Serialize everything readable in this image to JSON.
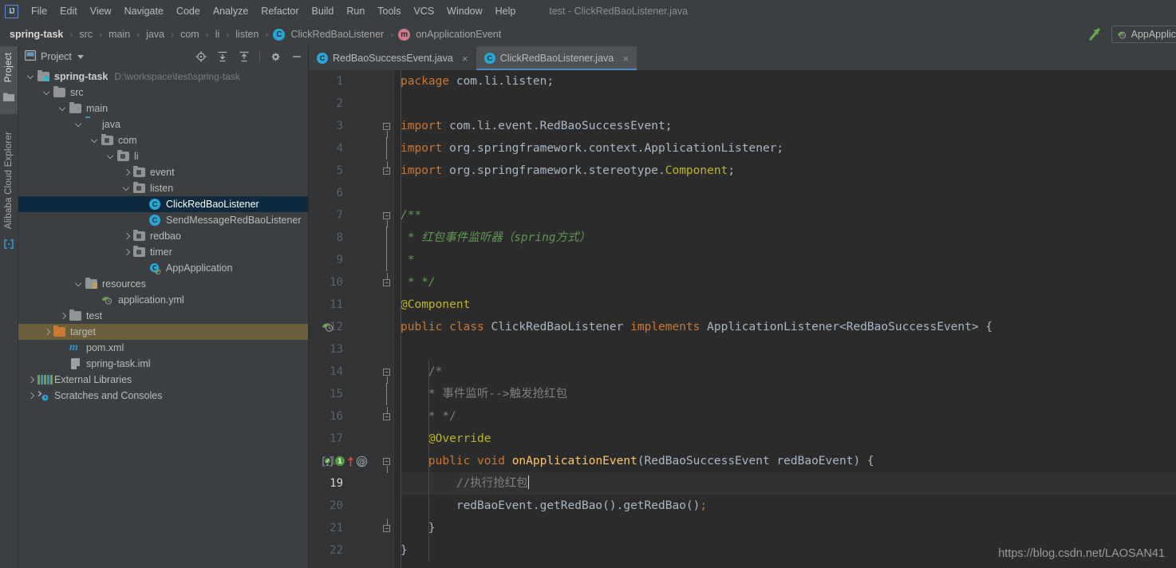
{
  "app": {
    "logo_text": "IJ",
    "window_title": "test - ClickRedBaoListener.java"
  },
  "menubar": {
    "items": [
      {
        "label": "File"
      },
      {
        "label": "Edit"
      },
      {
        "label": "View"
      },
      {
        "label": "Navigate"
      },
      {
        "label": "Code"
      },
      {
        "label": "Analyze"
      },
      {
        "label": "Refactor"
      },
      {
        "label": "Build"
      },
      {
        "label": "Run"
      },
      {
        "label": "Tools"
      },
      {
        "label": "VCS"
      },
      {
        "label": "Window"
      },
      {
        "label": "Help"
      }
    ]
  },
  "breadcrumb": {
    "items": [
      {
        "label": "spring-task",
        "icon": "none"
      },
      {
        "label": "src",
        "icon": "none"
      },
      {
        "label": "main",
        "icon": "none"
      },
      {
        "label": "java",
        "icon": "none"
      },
      {
        "label": "com",
        "icon": "none"
      },
      {
        "label": "li",
        "icon": "none"
      },
      {
        "label": "listen",
        "icon": "none"
      },
      {
        "label": "ClickRedBaoListener",
        "icon": "class-icon"
      },
      {
        "label": "onApplicationEvent",
        "icon": "method-icon"
      }
    ],
    "separator": "›"
  },
  "toolbar_right": {
    "run_config_label": "AppApplication",
    "run_icon": "run-arrow-icon",
    "config_icon": "spring-boot-icon",
    "accent_green": "#6aa84f"
  },
  "tool_strip": {
    "tabs": [
      {
        "label": "Project",
        "icon": "project-folder-icon",
        "active": true
      },
      {
        "label": "Alibaba Cloud Explorer",
        "icon": "cloud-bracket-icon",
        "active": false
      }
    ]
  },
  "project_panel": {
    "title": "Project",
    "tools": [
      {
        "name": "locate-icon"
      },
      {
        "name": "expand-all-icon"
      },
      {
        "name": "collapse-all-icon"
      },
      {
        "name": "settings-gear-icon"
      },
      {
        "name": "hide-panel-icon"
      }
    ],
    "tree": [
      {
        "label": "spring-task",
        "detail": "D:\\workspace\\test\\spring-task",
        "indent": 0,
        "arrow": "down",
        "icon": "module-folder",
        "bold": true
      },
      {
        "label": "src",
        "detail": "",
        "indent": 1,
        "arrow": "down",
        "icon": "folder-src",
        "bold": false
      },
      {
        "label": "main",
        "detail": "",
        "indent": 2,
        "arrow": "down",
        "icon": "folder-plain",
        "bold": false
      },
      {
        "label": "java",
        "detail": "",
        "indent": 3,
        "arrow": "down",
        "icon": "folder-sources",
        "bold": false
      },
      {
        "label": "com",
        "detail": "",
        "indent": 4,
        "arrow": "down",
        "icon": "folder-package",
        "bold": false
      },
      {
        "label": "li",
        "detail": "",
        "indent": 5,
        "arrow": "down",
        "icon": "folder-package",
        "bold": false
      },
      {
        "label": "event",
        "detail": "",
        "indent": 6,
        "arrow": "right",
        "icon": "folder-package",
        "bold": false
      },
      {
        "label": "listen",
        "detail": "",
        "indent": 6,
        "arrow": "down",
        "icon": "folder-package",
        "bold": false
      },
      {
        "label": "ClickRedBaoListener",
        "detail": "",
        "indent": 7,
        "arrow": "none",
        "icon": "java-class",
        "bold": false,
        "selected": true
      },
      {
        "label": "SendMessageRedBaoListener",
        "detail": "",
        "indent": 7,
        "arrow": "none",
        "icon": "java-class",
        "bold": false
      },
      {
        "label": "redbao",
        "detail": "",
        "indent": 6,
        "arrow": "right",
        "icon": "folder-package",
        "bold": false
      },
      {
        "label": "timer",
        "detail": "",
        "indent": 6,
        "arrow": "right",
        "icon": "folder-package",
        "bold": false
      },
      {
        "label": "AppApplication",
        "detail": "",
        "indent": 7,
        "arrow": "none",
        "icon": "spring-boot-class",
        "bold": false
      },
      {
        "label": "resources",
        "detail": "",
        "indent": 3,
        "arrow": "down",
        "icon": "folder-resources",
        "bold": false
      },
      {
        "label": "application.yml",
        "detail": "",
        "indent": 4,
        "arrow": "none",
        "icon": "spring-yml",
        "bold": false
      },
      {
        "label": "test",
        "detail": "",
        "indent": 2,
        "arrow": "right",
        "icon": "folder-plain",
        "bold": false
      },
      {
        "label": "target",
        "detail": "",
        "indent": 1,
        "arrow": "right",
        "icon": "folder-target",
        "bold": false,
        "excluded_highlight": true
      },
      {
        "label": "pom.xml",
        "detail": "",
        "indent": 2,
        "arrow": "none",
        "icon": "maven-icon",
        "bold": false
      },
      {
        "label": "spring-task.iml",
        "detail": "",
        "indent": 2,
        "arrow": "none",
        "icon": "iml-icon",
        "bold": false
      },
      {
        "label": "External Libraries",
        "detail": "",
        "indent": 0,
        "arrow": "right",
        "icon": "libraries-icon",
        "bold": false
      },
      {
        "label": "Scratches and Consoles",
        "detail": "",
        "indent": 0,
        "arrow": "right",
        "icon": "scratches-icon",
        "bold": false
      }
    ]
  },
  "editor": {
    "tabs": [
      {
        "label": "RedBaoSuccessEvent.java",
        "active": false,
        "close": "×"
      },
      {
        "label": "ClickRedBaoListener.java",
        "active": true,
        "close": "×"
      }
    ],
    "current_line": 19,
    "lines": [
      {
        "n": 1,
        "tokens": [
          {
            "t": "package ",
            "c": "kw"
          },
          {
            "t": "com.li.listen;",
            "c": "id"
          }
        ],
        "indent": 0
      },
      {
        "n": 2,
        "tokens": [],
        "indent": 0
      },
      {
        "n": 3,
        "tokens": [
          {
            "t": "import ",
            "c": "kw"
          },
          {
            "t": "com.li.event.RedBaoSuccessEvent;",
            "c": "id"
          }
        ],
        "indent": 0,
        "fold": "top"
      },
      {
        "n": 4,
        "tokens": [
          {
            "t": "import ",
            "c": "kw"
          },
          {
            "t": "org.springframework.context.ApplicationListener;",
            "c": "id"
          }
        ],
        "indent": 0,
        "fold": "line"
      },
      {
        "n": 5,
        "tokens": [
          {
            "t": "import ",
            "c": "kw"
          },
          {
            "t": "org.springframework.stereotype.",
            "c": "id"
          },
          {
            "t": "Component",
            "c": "type-hi"
          },
          {
            "t": ";",
            "c": "id"
          }
        ],
        "indent": 0,
        "fold": "bot"
      },
      {
        "n": 6,
        "tokens": [],
        "indent": 0
      },
      {
        "n": 7,
        "tokens": [
          {
            "t": "/**",
            "c": "doc"
          }
        ],
        "indent": 0,
        "fold": "top"
      },
      {
        "n": 8,
        "tokens": [
          {
            "t": " * 红包事件监听器（spring方式）",
            "c": "doc"
          }
        ],
        "indent": 0,
        "fold": "line"
      },
      {
        "n": 9,
        "tokens": [
          {
            "t": " *",
            "c": "doc"
          }
        ],
        "indent": 0,
        "fold": "line"
      },
      {
        "n": 10,
        "tokens": [
          {
            "t": " * */",
            "c": "doc"
          }
        ],
        "indent": 0,
        "fold": "bot"
      },
      {
        "n": 11,
        "tokens": [
          {
            "t": "@Component",
            "c": "ann"
          }
        ],
        "indent": 0
      },
      {
        "n": 12,
        "tokens": [
          {
            "t": "public ",
            "c": "kw"
          },
          {
            "t": "class ",
            "c": "kw"
          },
          {
            "t": "ClickRedBaoListener ",
            "c": "id"
          },
          {
            "t": "implements ",
            "c": "kw"
          },
          {
            "t": "ApplicationListener<RedBaoSuccessEvent> {",
            "c": "id"
          }
        ],
        "indent": 0,
        "gutter_icon": "spring-bean-icon"
      },
      {
        "n": 13,
        "tokens": [],
        "indent": 0
      },
      {
        "n": 14,
        "tokens": [
          {
            "t": "    /*",
            "c": "cmt"
          }
        ],
        "indent": 1,
        "fold": "top"
      },
      {
        "n": 15,
        "tokens": [
          {
            "t": "    * 事件监听-->触发抢红包",
            "c": "cmt"
          }
        ],
        "indent": 1,
        "fold": "line"
      },
      {
        "n": 16,
        "tokens": [
          {
            "t": "    * */",
            "c": "cmt"
          }
        ],
        "indent": 1,
        "fold": "bot"
      },
      {
        "n": 17,
        "tokens": [
          {
            "t": "    @Override",
            "c": "ann"
          }
        ],
        "indent": 1
      },
      {
        "n": 18,
        "tokens": [
          {
            "t": "    ",
            "c": "id"
          },
          {
            "t": "public ",
            "c": "kw"
          },
          {
            "t": "void ",
            "c": "kw"
          },
          {
            "t": "onApplicationEvent",
            "c": "fn"
          },
          {
            "t": "(RedBaoSuccessEvent redBaoEvent) {",
            "c": "id"
          }
        ],
        "indent": 1,
        "gutter_marks": [
          "implementing-method-icon",
          "bean-usage-icon",
          "override-arrow-icon",
          "annotation-icon"
        ],
        "fold": "top"
      },
      {
        "n": 19,
        "tokens": [
          {
            "t": "        //执行抢红包",
            "c": "cmt"
          }
        ],
        "indent": 2,
        "current": true,
        "caret": true
      },
      {
        "n": 20,
        "tokens": [
          {
            "t": "        redBaoEvent.getRedBao().getRedBao",
            "c": "id"
          },
          {
            "t": "()",
            "c": "id"
          },
          {
            "t": ";",
            "c": "kw"
          }
        ],
        "indent": 2
      },
      {
        "n": 21,
        "tokens": [
          {
            "t": "    }",
            "c": "id"
          }
        ],
        "indent": 1,
        "fold": "bot"
      },
      {
        "n": 22,
        "tokens": [
          {
            "t": "}",
            "c": "id"
          }
        ],
        "indent": 0
      }
    ]
  },
  "watermark": {
    "text": "https://blog.csdn.net/LAOSAN41"
  }
}
